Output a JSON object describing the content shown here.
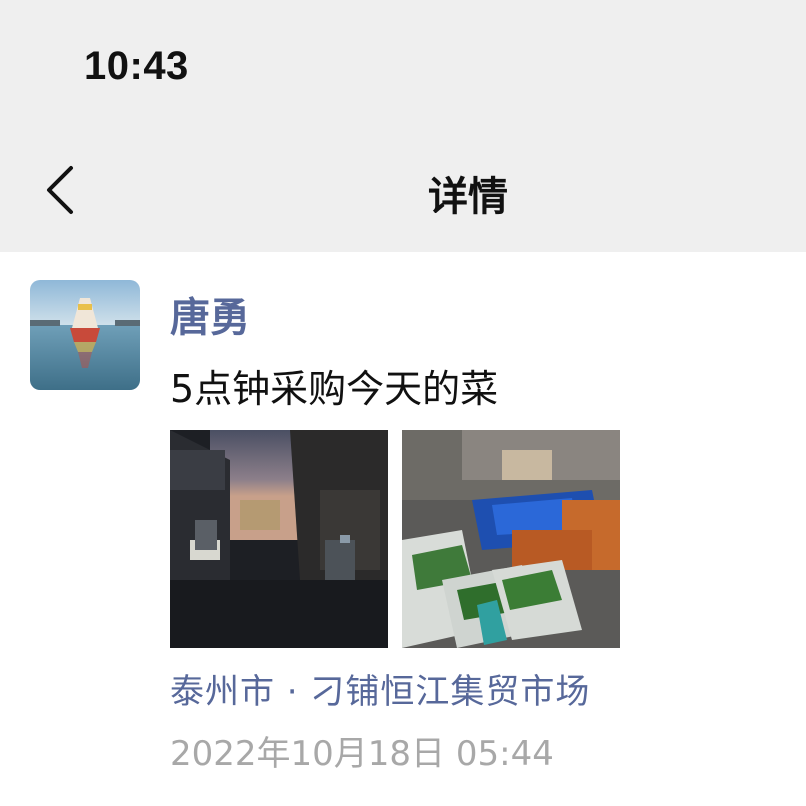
{
  "status_bar": {
    "time": "10:43"
  },
  "nav": {
    "title": "详情",
    "back_icon": "chevron-left-icon"
  },
  "post": {
    "author": "唐勇",
    "text": "5点钟采购今天的菜",
    "location": "泰州市 · 刁铺恒江集贸市场",
    "timestamp": "2022年10月18日 05:44",
    "photos": [
      "street-at-dawn-photo",
      "vegetable-crates-photo"
    ]
  },
  "colors": {
    "topbar_bg": "#efefef",
    "link": "#57689a",
    "timestamp": "#a8a8a8"
  }
}
